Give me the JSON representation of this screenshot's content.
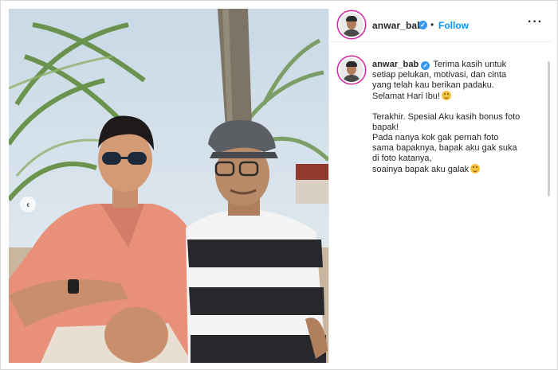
{
  "post": {
    "username": "anwar_bab",
    "verified_icon": "verified-badge-icon",
    "separator": "•",
    "follow_label": "Follow",
    "more_icon": "more-options-icon",
    "more_glyph": "···",
    "prev_glyph": "‹"
  },
  "caption": {
    "username": "anwar_bab",
    "first_line": "Terima kasih untuk",
    "lines": [
      "setiap pelukan, motivasi, dan cinta",
      "yang telah kau berikan padaku.",
      "Selamat Hari Ibu!"
    ],
    "paragraph2": [
      "Terakhir. Spesial Aku kasih bonus foto",
      "bapak!",
      "Pada nanya kok gak pernah foto",
      "sama bapaknya, bapak aku gak suka",
      "di foto katanya,",
      "soainya bapak aku galak"
    ],
    "emoji_icons": [
      "smiling-face-hearts-emoji",
      "grinning-face-emoji"
    ]
  },
  "colors": {
    "accent": "#0095f6",
    "verified": "#3897f0",
    "story_ring": "#d6249f",
    "text": "#262626"
  }
}
